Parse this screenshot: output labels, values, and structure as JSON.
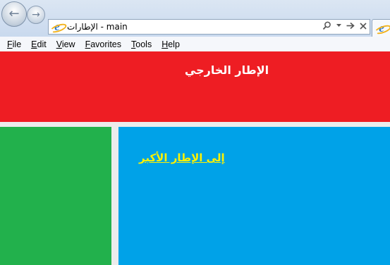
{
  "browser": {
    "page_title": "الإطارات - main",
    "address_tools": {
      "search_icon": "search-icon",
      "dropdown_icon": "chevron-down-icon",
      "go_icon": "arrow-right-icon",
      "stop_icon": "close-icon"
    },
    "nav": {
      "back_glyph": "←",
      "forward_glyph": "→"
    }
  },
  "menubar": {
    "items": [
      {
        "label": "File",
        "accel": "F",
        "rest": "ile"
      },
      {
        "label": "Edit",
        "accel": "E",
        "rest": "dit"
      },
      {
        "label": "View",
        "accel": "V",
        "rest": "iew"
      },
      {
        "label": "Favorites",
        "accel": "F",
        "rest": "avorites"
      },
      {
        "label": "Tools",
        "accel": "T",
        "rest": "ools"
      },
      {
        "label": "Help",
        "accel": "H",
        "rest": "elp"
      }
    ]
  },
  "frames": {
    "outer": {
      "heading": "الإطار الخارجي",
      "color": "#ee1d23"
    },
    "left": {
      "color": "#22b14c"
    },
    "right": {
      "link_text": "إلى الإطار الأكبر",
      "color": "#00a2e8",
      "link_color": "#fff200"
    }
  }
}
